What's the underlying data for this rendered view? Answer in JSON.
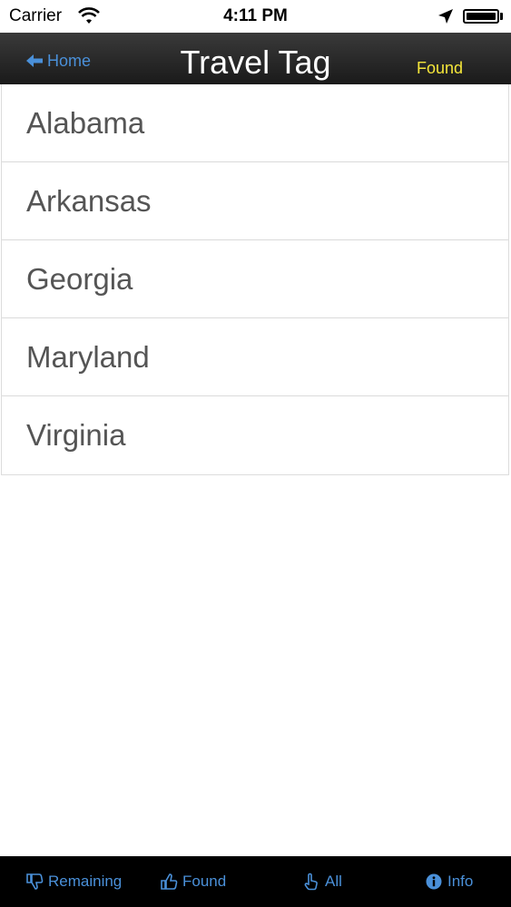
{
  "status_bar": {
    "carrier": "Carrier",
    "time": "4:11 PM"
  },
  "nav": {
    "back_label": "Home",
    "title": "Travel Tag",
    "right_label": "Found"
  },
  "list": {
    "items": [
      "Alabama",
      "Arkansas",
      "Georgia",
      "Maryland",
      "Virginia"
    ]
  },
  "tabs": [
    {
      "label": "Remaining",
      "icon": "thumbs-down-icon"
    },
    {
      "label": "Found",
      "icon": "thumbs-up-icon"
    },
    {
      "label": "All",
      "icon": "hand-pointer-icon"
    },
    {
      "label": "Info",
      "icon": "info-icon"
    }
  ],
  "colors": {
    "nav_background": "#2a2a2a",
    "accent_blue": "#4a90d9",
    "found_yellow": "#f5e63a",
    "list_text": "#555555",
    "tab_bar": "#000000"
  }
}
